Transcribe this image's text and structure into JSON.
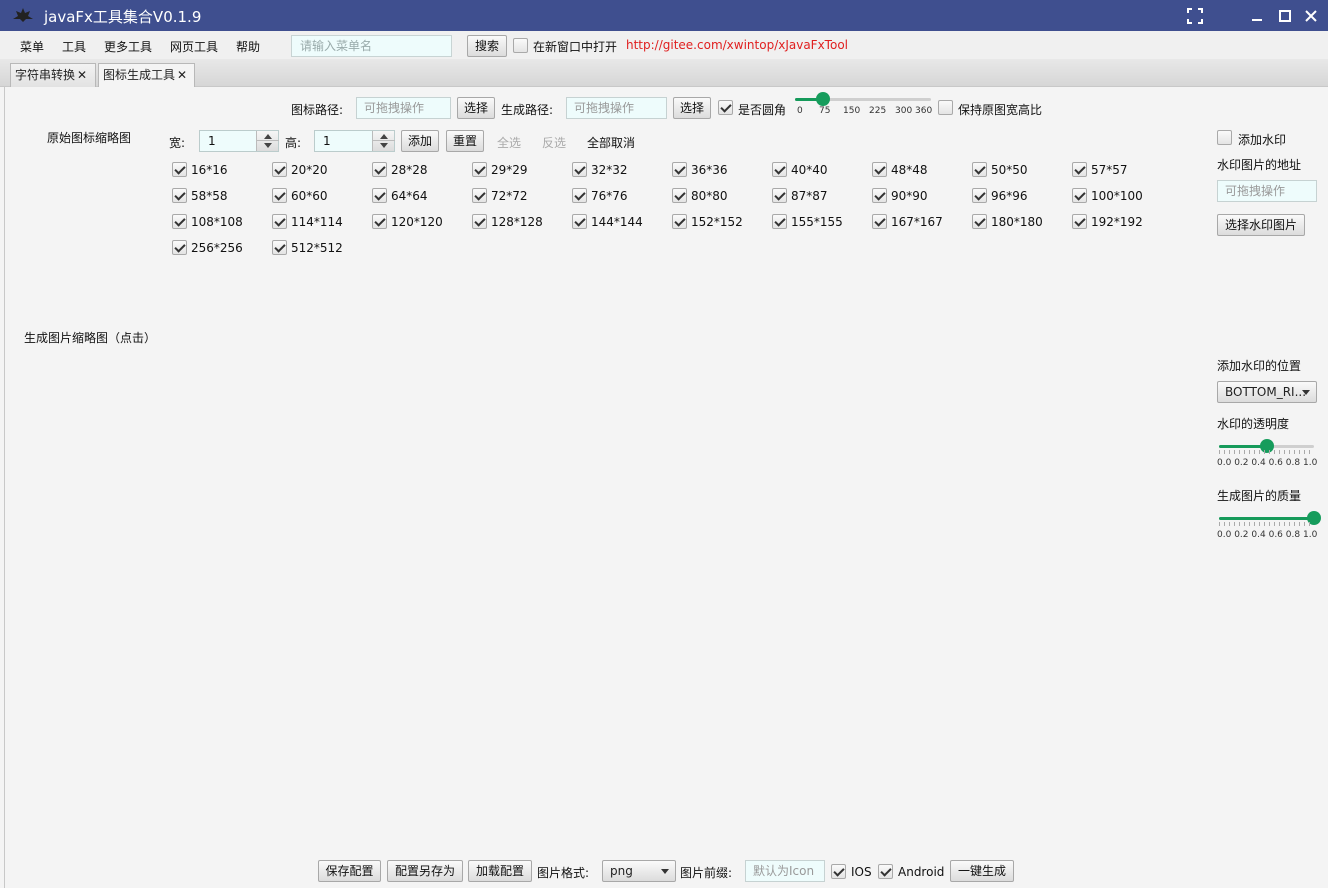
{
  "window": {
    "title": "javaFx工具集合V0.1.9"
  },
  "menu": {
    "items": [
      "菜单",
      "工具",
      "更多工具",
      "网页工具",
      "帮助"
    ],
    "search_placeholder": "请输入菜单名",
    "search_button": "搜索",
    "new_window_label": "在新窗口中打开",
    "link": "http://gitee.com/xwintop/xJavaFxTool"
  },
  "tabs": [
    {
      "label": "字符串转换"
    },
    {
      "label": "图标生成工具"
    }
  ],
  "toolbar": {
    "icon_path_label": "图标路径:",
    "icon_path_placeholder": "可拖拽操作",
    "select_button": "选择",
    "output_path_label": "生成路径:",
    "output_path_placeholder": "可拖拽操作",
    "select_button_2": "选择",
    "rounded_label": "是否圆角",
    "rounded_checked": true,
    "radius_slider": {
      "value": 75,
      "min": 0,
      "max": 360,
      "ticks": [
        "0",
        "75",
        "150",
        "225",
        "300",
        "360"
      ]
    },
    "keep_ratio_label": "保持原图宽高比",
    "keep_ratio_checked": false
  },
  "original_thumb_label": "原始图标缩略图",
  "size_row": {
    "width_label": "宽:",
    "width_value": "1",
    "height_label": "高:",
    "height_value": "1",
    "add_button": "添加",
    "reset_button": "重置",
    "select_all": "全选",
    "invert": "反选",
    "cancel_all": "全部取消"
  },
  "sizes": [
    "16*16",
    "20*20",
    "28*28",
    "29*29",
    "32*32",
    "36*36",
    "40*40",
    "48*48",
    "50*50",
    "57*57",
    "58*58",
    "60*60",
    "64*64",
    "72*72",
    "76*76",
    "80*80",
    "87*87",
    "90*90",
    "96*96",
    "100*100",
    "108*108",
    "114*114",
    "120*120",
    "128*128",
    "144*144",
    "152*152",
    "155*155",
    "167*167",
    "180*180",
    "192*192",
    "256*256",
    "512*512"
  ],
  "generated_thumb_label": "生成图片缩略图（点击）",
  "watermark": {
    "add_label": "添加水印",
    "add_checked": false,
    "address_label": "水印图片的地址",
    "address_placeholder": "可拖拽操作",
    "choose_button": "选择水印图片",
    "position_label": "添加水印的位置",
    "position_value": "BOTTOM_RI...",
    "opacity_label": "水印的透明度",
    "opacity_value": 0.5,
    "quality_label": "生成图片的质量",
    "quality_value": 1.0,
    "scale_ticks": [
      "0.0",
      "0.2",
      "0.4",
      "0.6",
      "0.8",
      "1.0"
    ]
  },
  "footer": {
    "save_config": "保存配置",
    "save_config_as": "配置另存为",
    "load_config": "加载配置",
    "format_label": "图片格式:",
    "format_value": "png",
    "prefix_label": "图片前缀:",
    "prefix_placeholder": "默认为Icon",
    "ios_label": "IOS",
    "ios_checked": true,
    "android_label": "Android",
    "android_checked": true,
    "generate_button": "一键生成"
  },
  "colors": {
    "titlebar": "#3f4f8f",
    "accent": "#169c5c",
    "link": "#e02020",
    "input_bg": "#eefcfc"
  }
}
